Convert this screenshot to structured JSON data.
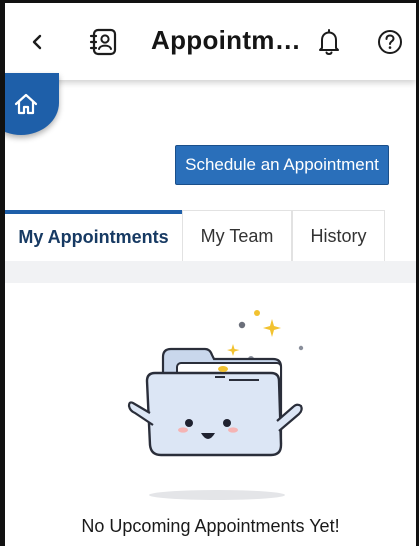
{
  "header": {
    "title": "Appointm…",
    "icons": {
      "back": "chevron-left-icon",
      "contacts": "contacts-book-icon",
      "notifications": "bell-icon",
      "help": "help-circle-icon"
    }
  },
  "home_button": {
    "icon": "home-icon"
  },
  "actions": {
    "schedule_label": "Schedule an Appointment"
  },
  "tabs": [
    {
      "label": "My Appointments",
      "active": true
    },
    {
      "label": "My Team",
      "active": false
    },
    {
      "label": "History",
      "active": false
    }
  ],
  "empty_state": {
    "illustration": "empty-folder-illustration",
    "message": "No Upcoming Appointments Yet!"
  },
  "colors": {
    "brand": "#1e5fa9",
    "button": "#2a6fba",
    "sparkle": "#f2c230"
  }
}
